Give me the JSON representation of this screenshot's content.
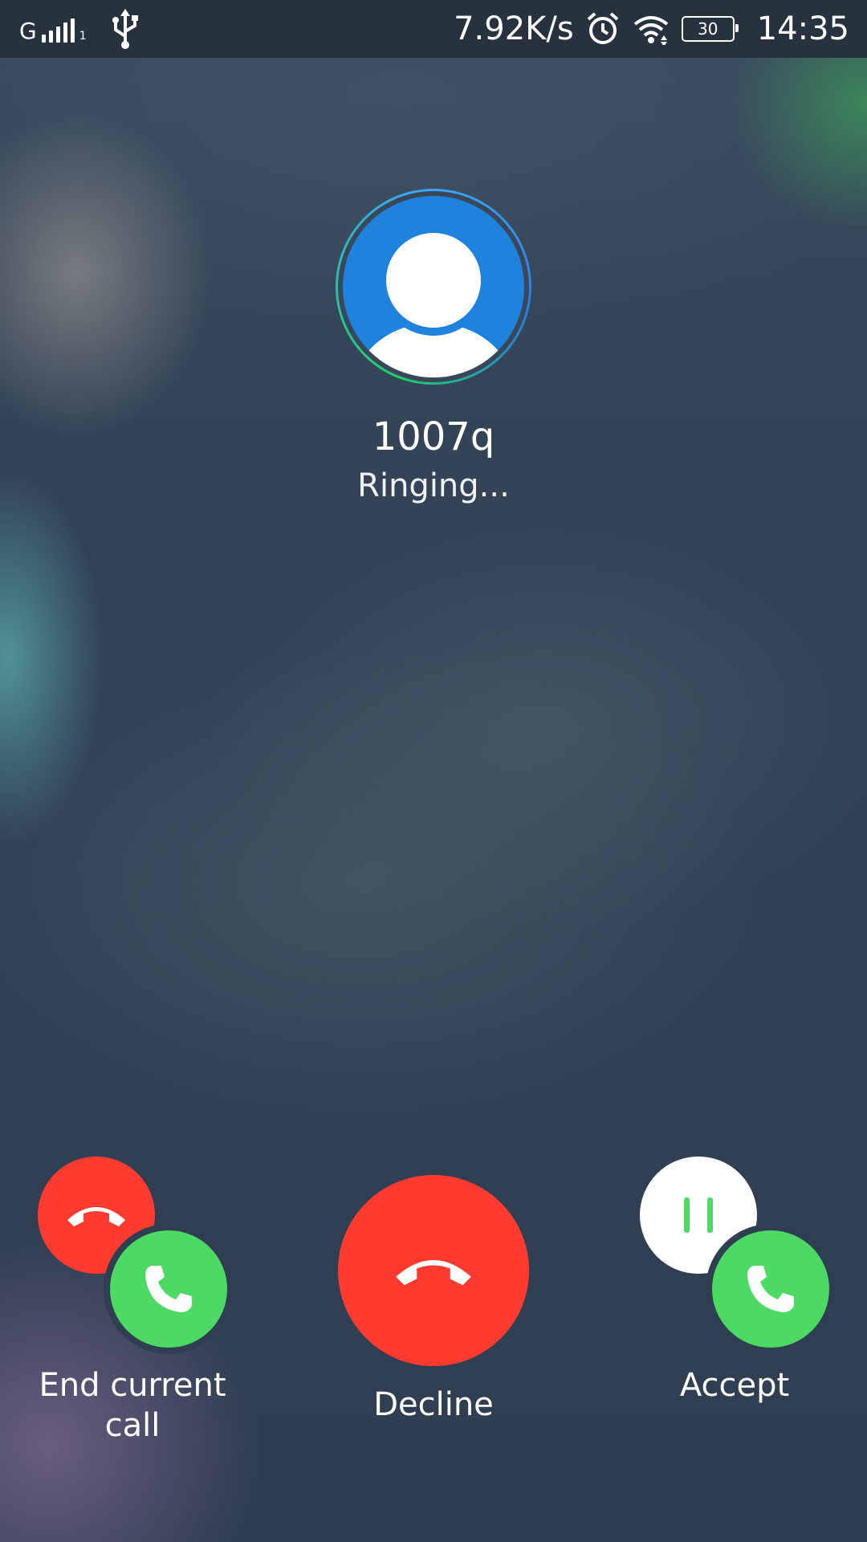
{
  "status_bar": {
    "network_type": "G",
    "sim_index": "1",
    "net_speed": "7.92K/s",
    "battery_level": "30",
    "time": "14:35",
    "icons": [
      "signal-icon",
      "usb-icon",
      "alarm-icon",
      "wifi-icon",
      "battery-icon"
    ]
  },
  "caller": {
    "name": "1007q",
    "status": "Ringing..."
  },
  "actions": {
    "end_current_call": {
      "label_line1": "End current",
      "label_line2": "call"
    },
    "decline": {
      "label": "Decline"
    },
    "accept": {
      "label": "Accept"
    }
  },
  "colors": {
    "decline_red": "#ff3b30",
    "accept_green": "#4cd964",
    "avatar_blue": "#1f82dd"
  }
}
